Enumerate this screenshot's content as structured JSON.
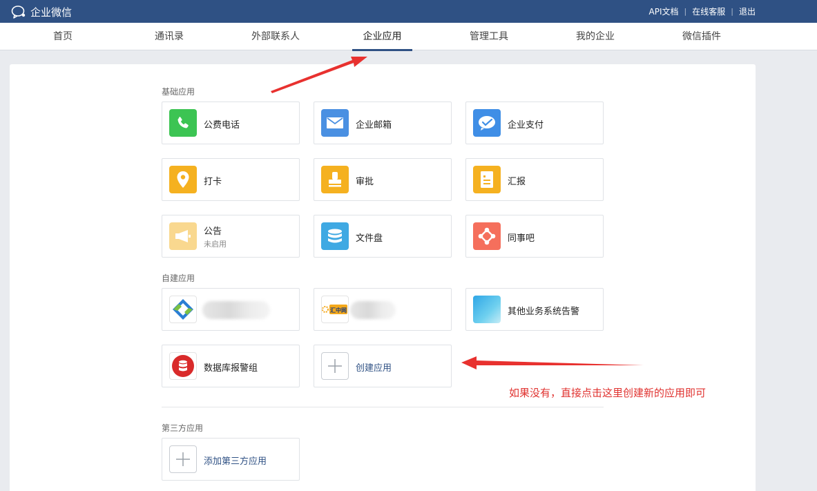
{
  "header": {
    "brand": "企业微信",
    "links": [
      "API文档",
      "在线客服",
      "退出"
    ]
  },
  "nav": {
    "tabs": [
      "首页",
      "通讯录",
      "外部联系人",
      "企业应用",
      "管理工具",
      "我的企业",
      "微信插件"
    ],
    "active": "企业应用"
  },
  "sections": {
    "basic_title": "基础应用",
    "custom_title": "自建应用",
    "third_title": "第三方应用"
  },
  "basic_apps": [
    {
      "name": "公费电话",
      "icon": "phone-icon",
      "color": "#3cc453"
    },
    {
      "name": "企业邮箱",
      "icon": "mail-icon",
      "color": "#4a90e2"
    },
    {
      "name": "企业支付",
      "icon": "pay-icon",
      "color": "#3f8ee6"
    },
    {
      "name": "打卡",
      "icon": "location-icon",
      "color": "#f5b120"
    },
    {
      "name": "审批",
      "icon": "stamp-icon",
      "color": "#f5b120"
    },
    {
      "name": "汇报",
      "icon": "report-icon",
      "color": "#f5b120"
    },
    {
      "name": "公告",
      "status": "未启用",
      "icon": "megaphone-icon",
      "color": "#f9d88f"
    },
    {
      "name": "文件盘",
      "icon": "disk-icon",
      "color": "#3fa9e3"
    },
    {
      "name": "同事吧",
      "icon": "colleague-icon",
      "color": "#f56f5c"
    }
  ],
  "custom_apps": [
    {
      "name": "",
      "icon": "app-logo-icon"
    },
    {
      "name": "",
      "icon": "huizhong-logo-icon",
      "logo_text": "汇中网"
    },
    {
      "name": "其他业务系统告警",
      "icon": "gradient-tile-icon"
    },
    {
      "name": "数据库报警组",
      "icon": "database-icon",
      "color": "#d92a2a"
    },
    {
      "name": "创建应用",
      "icon": "plus-icon"
    }
  ],
  "third_apps": [
    {
      "name": "添加第三方应用",
      "icon": "plus-icon"
    }
  ],
  "annotation": {
    "text": "如果没有，直接点击这里创建新的应用即可",
    "color": "#e0322f"
  }
}
